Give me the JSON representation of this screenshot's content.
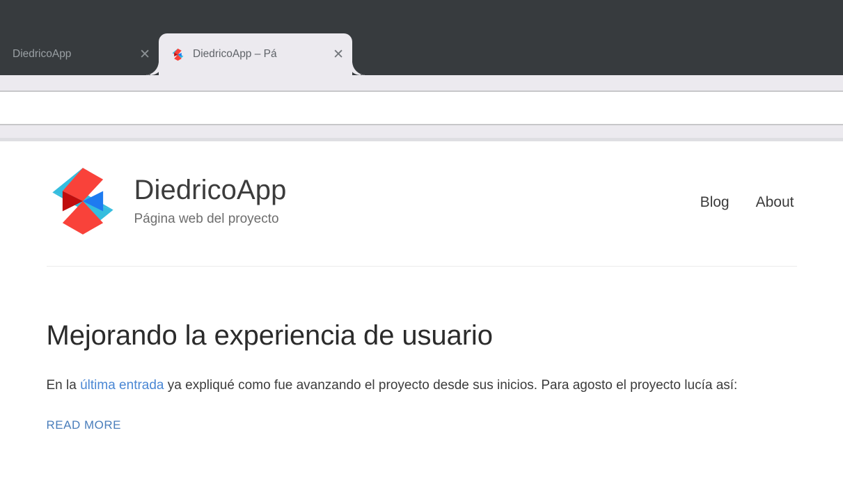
{
  "browser": {
    "tabs": [
      {
        "title": "DiedricoApp",
        "active": false,
        "has_favicon": false,
        "close_glyph": "✕",
        "close_icon_name": "tab-close-icon"
      },
      {
        "title": "DiedricoApp – Pá",
        "active": true,
        "has_favicon": true,
        "favicon_icon_name": "diedricoapp-favicon",
        "close_glyph": "✕",
        "close_icon_name": "tab-close-icon"
      }
    ],
    "colors": {
      "chrome_bg": "#373b3e",
      "active_tab_bg": "#eceaef",
      "inactive_tab_text": "#9aa0a4",
      "active_tab_text": "#5f6368",
      "toolbar_bg": "#eceaef",
      "toolbar_border": "#c7c7c9"
    }
  },
  "site": {
    "logo_icon_name": "diedricoapp-logo",
    "title": "DiedricoApp",
    "subtitle": "Página web del proyecto",
    "nav": [
      {
        "label": "Blog"
      },
      {
        "label": "About"
      }
    ]
  },
  "article": {
    "title": "Mejorando la experiencia de usuario",
    "body_before_link": "En la ",
    "body_link": "última entrada",
    "body_after_link": " ya expliqué como fue avanzando el proyecto desde sus inicios. Para agosto el proyecto lucía así:",
    "read_more": "READ MORE"
  },
  "colors": {
    "link_blue": "#4a87d4",
    "read_more_blue": "#4a7ebb",
    "heading_text": "#2b2b2b",
    "body_text": "#3b3b3b",
    "subtitle_text": "#6d6d6d",
    "rule": "#ececec",
    "logo_red": "#f9423a",
    "logo_dark_red": "#c00d0d",
    "logo_cyan": "#35bdde",
    "logo_blue": "#1e7bf0"
  }
}
